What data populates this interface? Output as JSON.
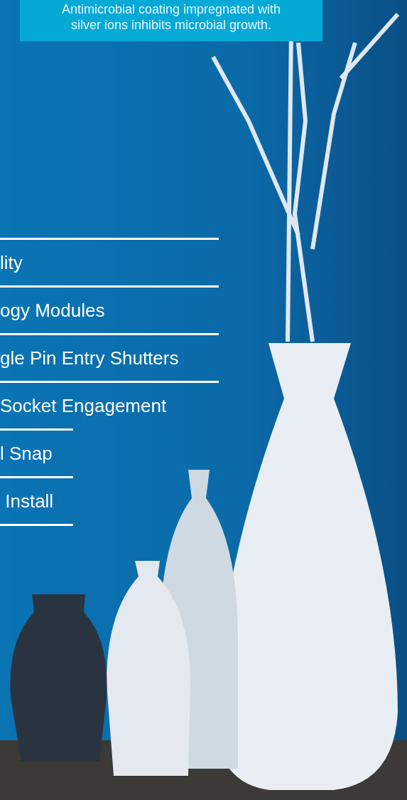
{
  "caption": {
    "text": "Antimicrobial coating impregnated with silver ions inhibits microbial growth."
  },
  "features": [
    {
      "label": "lity",
      "kind": "wide"
    },
    {
      "label": "ogy Modules",
      "kind": "wide"
    },
    {
      "label": "gle Pin Entry Shutters",
      "kind": "wide"
    },
    {
      "label": "Socket Engagement",
      "kind": "wide"
    },
    {
      "label": "l Snap",
      "kind": "narrow"
    },
    {
      "label": " Install",
      "kind": "narrow"
    }
  ]
}
